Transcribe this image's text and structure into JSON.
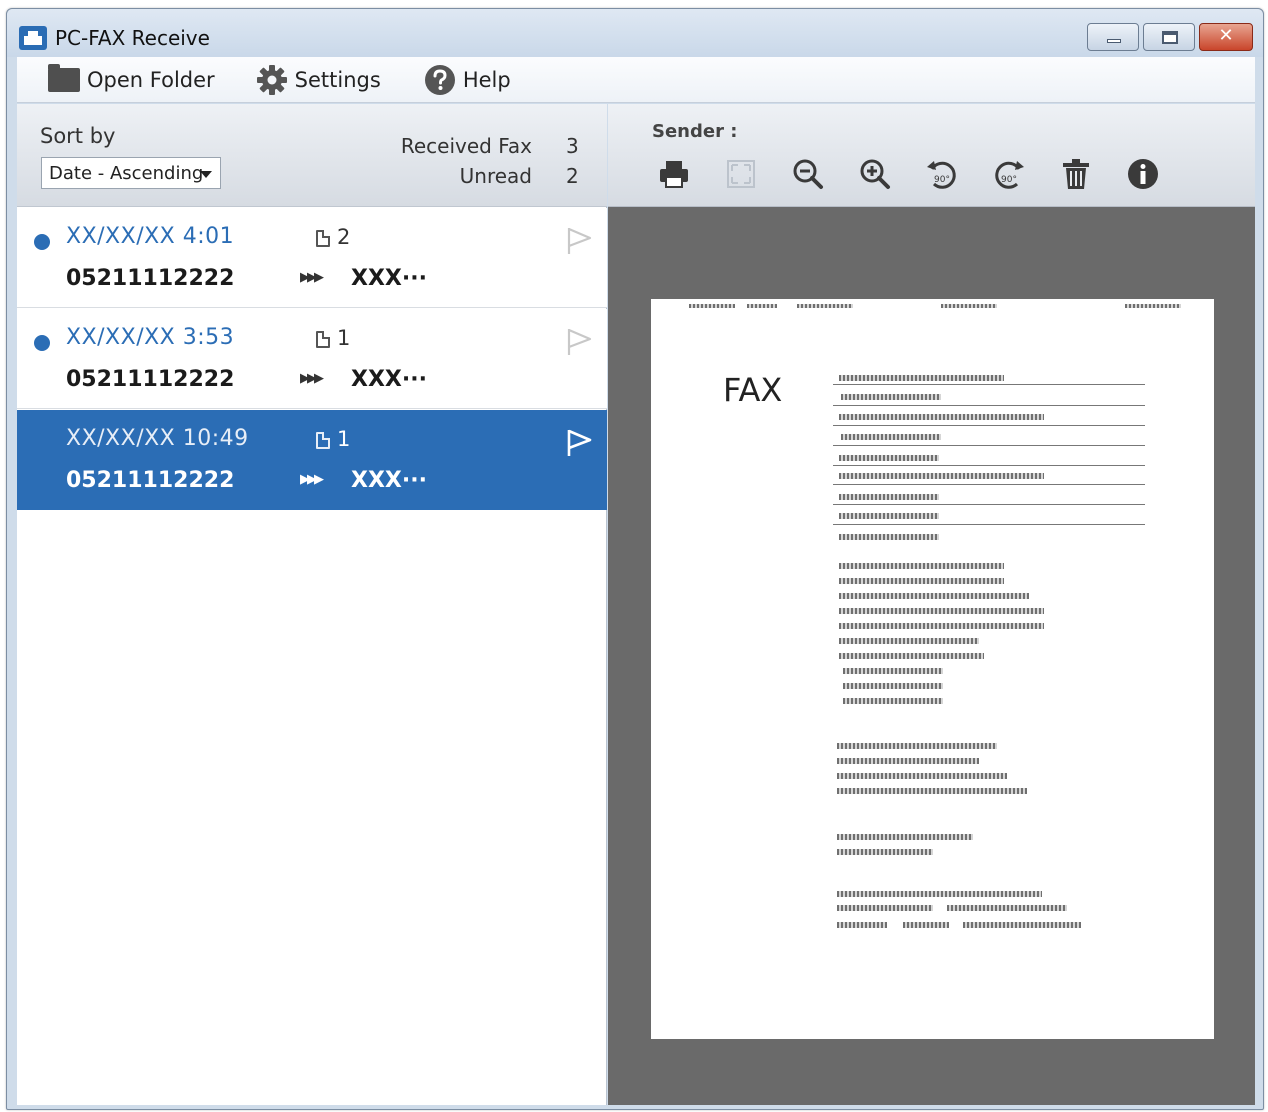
{
  "window": {
    "title": "PC-FAX Receive",
    "close_glyph": "✕"
  },
  "menu": {
    "open_folder": "Open Folder",
    "settings": "Settings",
    "help": "Help"
  },
  "sort": {
    "label": "Sort by",
    "selected": "Date - Ascending"
  },
  "stats": {
    "received_label": "Received Fax",
    "received_value": "3",
    "unread_label": "Unread",
    "unread_value": "2"
  },
  "faxes": [
    {
      "date": "XX/XX/XX 4:01",
      "pages": "2",
      "number": "05211112222",
      "sender": "XXX···",
      "unread": true,
      "selected": false
    },
    {
      "date": "XX/XX/XX 3:53",
      "pages": "1",
      "number": "05211112222",
      "sender": "XXX···",
      "unread": true,
      "selected": false
    },
    {
      "date": "XX/XX/XX 10:49",
      "pages": "1",
      "number": "05211112222",
      "sender": "XXX···",
      "unread": false,
      "selected": true
    }
  ],
  "viewer": {
    "sender_label": "Sender :",
    "toolbar": [
      "printer-icon",
      "fit-page-icon",
      "zoom-out-icon",
      "zoom-in-icon",
      "rotate-left-icon",
      "rotate-right-icon",
      "trash-icon",
      "info-icon"
    ],
    "rotate_left_label": "90°",
    "rotate_right_label": "90°",
    "fax_heading": "FAX"
  },
  "colors": {
    "accent": "#2b6db5",
    "viewer_background": "#6a6a6a"
  }
}
